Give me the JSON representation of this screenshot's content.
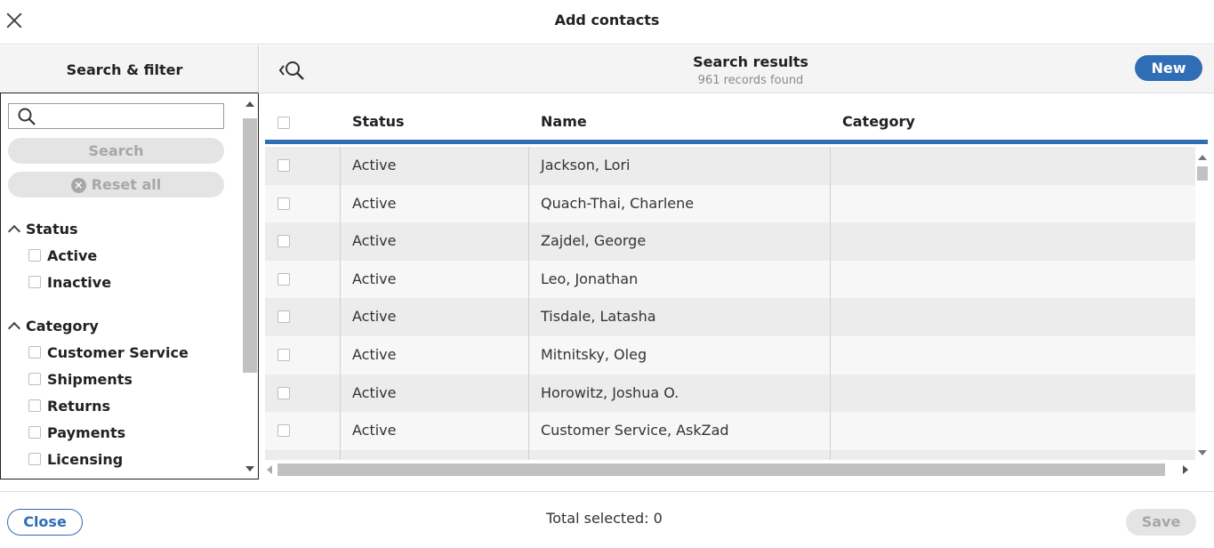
{
  "dialog": {
    "title": "Add contacts"
  },
  "left_panel": {
    "title": "Search & filter",
    "search_placeholder": "",
    "search_button": "Search",
    "reset_button": "Reset all",
    "reset_icon": "×",
    "sections": [
      {
        "label": "Status",
        "items": [
          "Active",
          "Inactive"
        ]
      },
      {
        "label": "Category",
        "items": [
          "Customer Service",
          "Shipments",
          "Returns",
          "Payments",
          "Licensing"
        ]
      }
    ]
  },
  "right_panel": {
    "title": "Search results",
    "subtitle": "961 records found",
    "new_button": "New",
    "columns": {
      "status": "Status",
      "name": "Name",
      "category": "Category"
    },
    "rows": [
      {
        "status": "Active",
        "name": "Jackson, Lori",
        "category": ""
      },
      {
        "status": "Active",
        "name": "Quach-Thai, Charlene",
        "category": ""
      },
      {
        "status": "Active",
        "name": "Zajdel, George",
        "category": ""
      },
      {
        "status": "Active",
        "name": "Leo, Jonathan",
        "category": ""
      },
      {
        "status": "Active",
        "name": "Tisdale, Latasha",
        "category": ""
      },
      {
        "status": "Active",
        "name": "Mitnitsky, Oleg",
        "category": ""
      },
      {
        "status": "Active",
        "name": "Horowitz, Joshua O.",
        "category": ""
      },
      {
        "status": "Active",
        "name": "Customer Service, AskZad",
        "category": ""
      }
    ]
  },
  "footer": {
    "close_button": "Close",
    "total_selected": "Total selected: 0",
    "save_button": "Save"
  },
  "colors": {
    "accent": "#2f6db5",
    "disabled_bg": "#e4e4e4",
    "disabled_text": "#a7a7a7"
  },
  "icons": {
    "close": "close-icon",
    "search": "search-icon",
    "back_search": "collapse-search-icon",
    "reset": "clear-circle-icon",
    "section_toggle": "chevron-up-icon"
  }
}
